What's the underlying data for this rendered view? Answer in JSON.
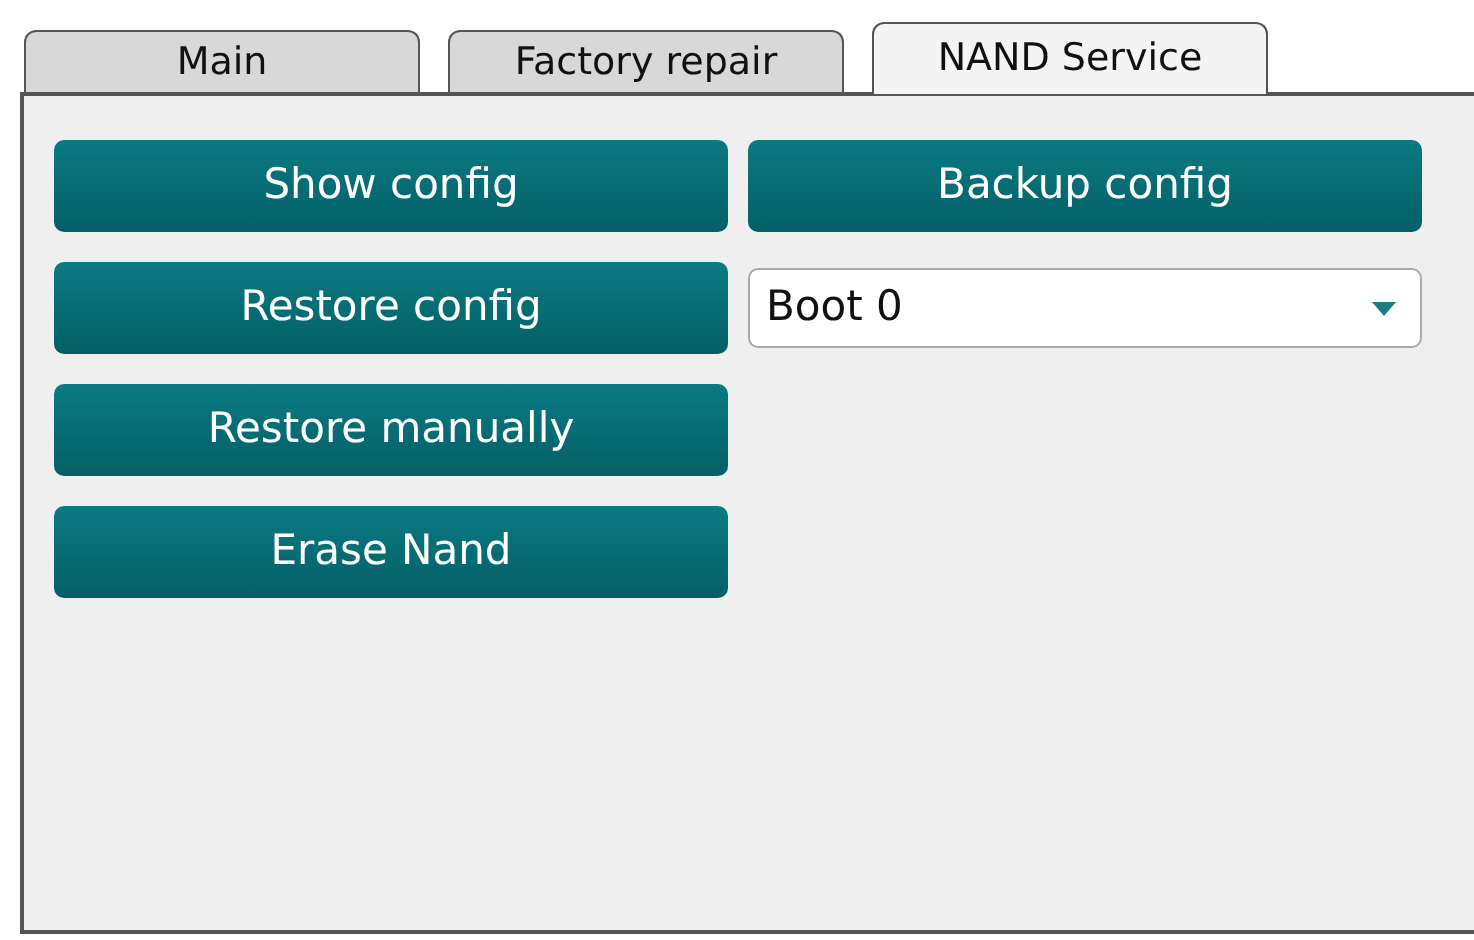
{
  "tabs": [
    {
      "label": "Main",
      "selected": false
    },
    {
      "label": "Factory repair",
      "selected": false
    },
    {
      "label": "NAND Service",
      "selected": true
    }
  ],
  "left_column": [
    {
      "kind": "button",
      "label": "Show config"
    },
    {
      "kind": "button",
      "label": "Restore config"
    },
    {
      "kind": "button",
      "label": "Restore manually"
    },
    {
      "kind": "button",
      "label": "Erase Nand"
    }
  ],
  "right_column": [
    {
      "kind": "button",
      "label": "Backup config"
    },
    {
      "kind": "dropdown",
      "value": "Boot 0"
    }
  ]
}
